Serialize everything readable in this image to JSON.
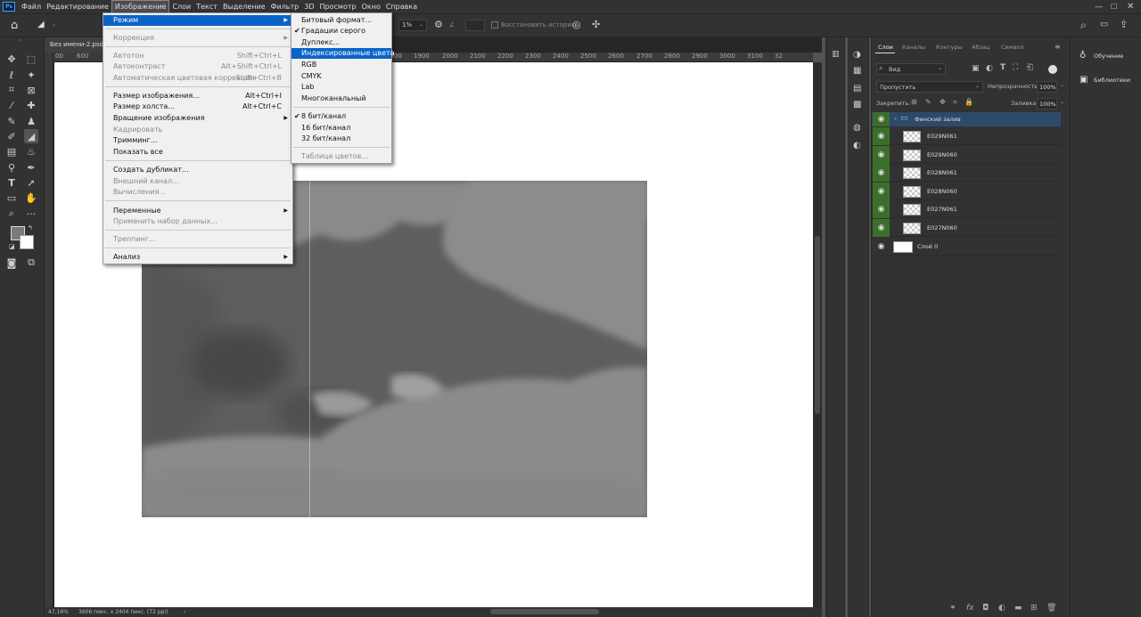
{
  "menubar": {
    "logo": "Ps",
    "items": [
      "Файл",
      "Редактирование",
      "Изображение",
      "Слои",
      "Текст",
      "Выделение",
      "Фильтр",
      "3D",
      "Просмотр",
      "Окно",
      "Справка"
    ]
  },
  "options": {
    "percent": "1%",
    "restore_history": "Восстановить историю"
  },
  "document": {
    "tab_title": "Без имени-2.psd",
    "ruler_marks": [
      "00",
      "600",
      "1800",
      "1900",
      "2000",
      "2100",
      "2200",
      "2300",
      "2400",
      "2500",
      "2600",
      "2700",
      "2800",
      "2900",
      "3000",
      "3100",
      "32"
    ],
    "zoom": "47,16%",
    "size_info": "3606 пикс. x 2404 пикс. (72 ppi)"
  },
  "image_menu": {
    "items": [
      {
        "label": "Режим",
        "shortcut": "",
        "submenu": true,
        "highlight": true,
        "disabled": false
      },
      {
        "label": "Коррекция",
        "shortcut": "",
        "submenu": true,
        "disabled": true
      },
      {
        "label": "Автотон",
        "shortcut": "Shift+Ctrl+L",
        "disabled": true
      },
      {
        "label": "Автоконтраст",
        "shortcut": "Alt+Shift+Ctrl+L",
        "disabled": true
      },
      {
        "label": "Автоматическая цветовая коррекция",
        "shortcut": "Shift+Ctrl+B",
        "disabled": true
      },
      {
        "label": "Размер изображения...",
        "shortcut": "Alt+Ctrl+I",
        "disabled": false
      },
      {
        "label": "Размер холста...",
        "shortcut": "Alt+Ctrl+C",
        "disabled": false
      },
      {
        "label": "Вращение изображения",
        "shortcut": "",
        "submenu": true,
        "disabled": false
      },
      {
        "label": "Кадрировать",
        "shortcut": "",
        "disabled": true
      },
      {
        "label": "Тримминг...",
        "shortcut": "",
        "disabled": false
      },
      {
        "label": "Показать все",
        "shortcut": "",
        "disabled": false
      },
      {
        "label": "Создать дубликат...",
        "shortcut": "",
        "disabled": false
      },
      {
        "label": "Внешний канал...",
        "shortcut": "",
        "disabled": true
      },
      {
        "label": "Вычисления...",
        "shortcut": "",
        "disabled": true
      },
      {
        "label": "Переменные",
        "shortcut": "",
        "submenu": true,
        "disabled": false
      },
      {
        "label": "Применить набор данных...",
        "shortcut": "",
        "disabled": true
      },
      {
        "label": "Треппинг...",
        "shortcut": "",
        "disabled": true
      },
      {
        "label": "Анализ",
        "shortcut": "",
        "submenu": true,
        "disabled": false
      }
    ]
  },
  "mode_menu": {
    "items": [
      {
        "label": "Битовый формат...",
        "checked": false,
        "disabled": false
      },
      {
        "label": "Градации серого",
        "checked": true,
        "disabled": false
      },
      {
        "label": "Дуплекс...",
        "checked": false,
        "disabled": false
      },
      {
        "label": "Индексированные цвета",
        "checked": false,
        "disabled": false,
        "highlight": true
      },
      {
        "label": "RGB",
        "checked": false,
        "disabled": false
      },
      {
        "label": "CMYK",
        "checked": false,
        "disabled": false
      },
      {
        "label": "Lab",
        "checked": false,
        "disabled": false
      },
      {
        "label": "Многоканальный",
        "checked": false,
        "disabled": false
      },
      {
        "label": "8 бит/канал",
        "checked": true,
        "disabled": false
      },
      {
        "label": "16 бит/канал",
        "checked": false,
        "disabled": false
      },
      {
        "label": "32 бит/канал",
        "checked": false,
        "disabled": false
      },
      {
        "label": "Таблица цветов...",
        "checked": false,
        "disabled": true
      }
    ]
  },
  "layers_panel": {
    "tabs": [
      "Слои",
      "Каналы",
      "Контуры",
      "Абзац",
      "Символ"
    ],
    "filter_kind": "Вид",
    "blend_mode": "Пропустить",
    "opacity_label": "Непрозрачность:",
    "opacity_value": "100%",
    "lock_label": "Закрепить:",
    "fill_label": "Заливка:",
    "fill_value": "100%",
    "group_name": "Финский залив",
    "layers": [
      "E029N061",
      "E029N060",
      "E028N061",
      "E028N060",
      "E027N061",
      "E027N060"
    ],
    "base_layer": "Слой 0"
  },
  "right_panel": {
    "learn": "Обучение",
    "libraries": "Библиотеки"
  },
  "colors": {
    "highlight": "#0a64c8",
    "eye_bg": "#3c6e2b",
    "group_bg": "#2d4a6b"
  }
}
